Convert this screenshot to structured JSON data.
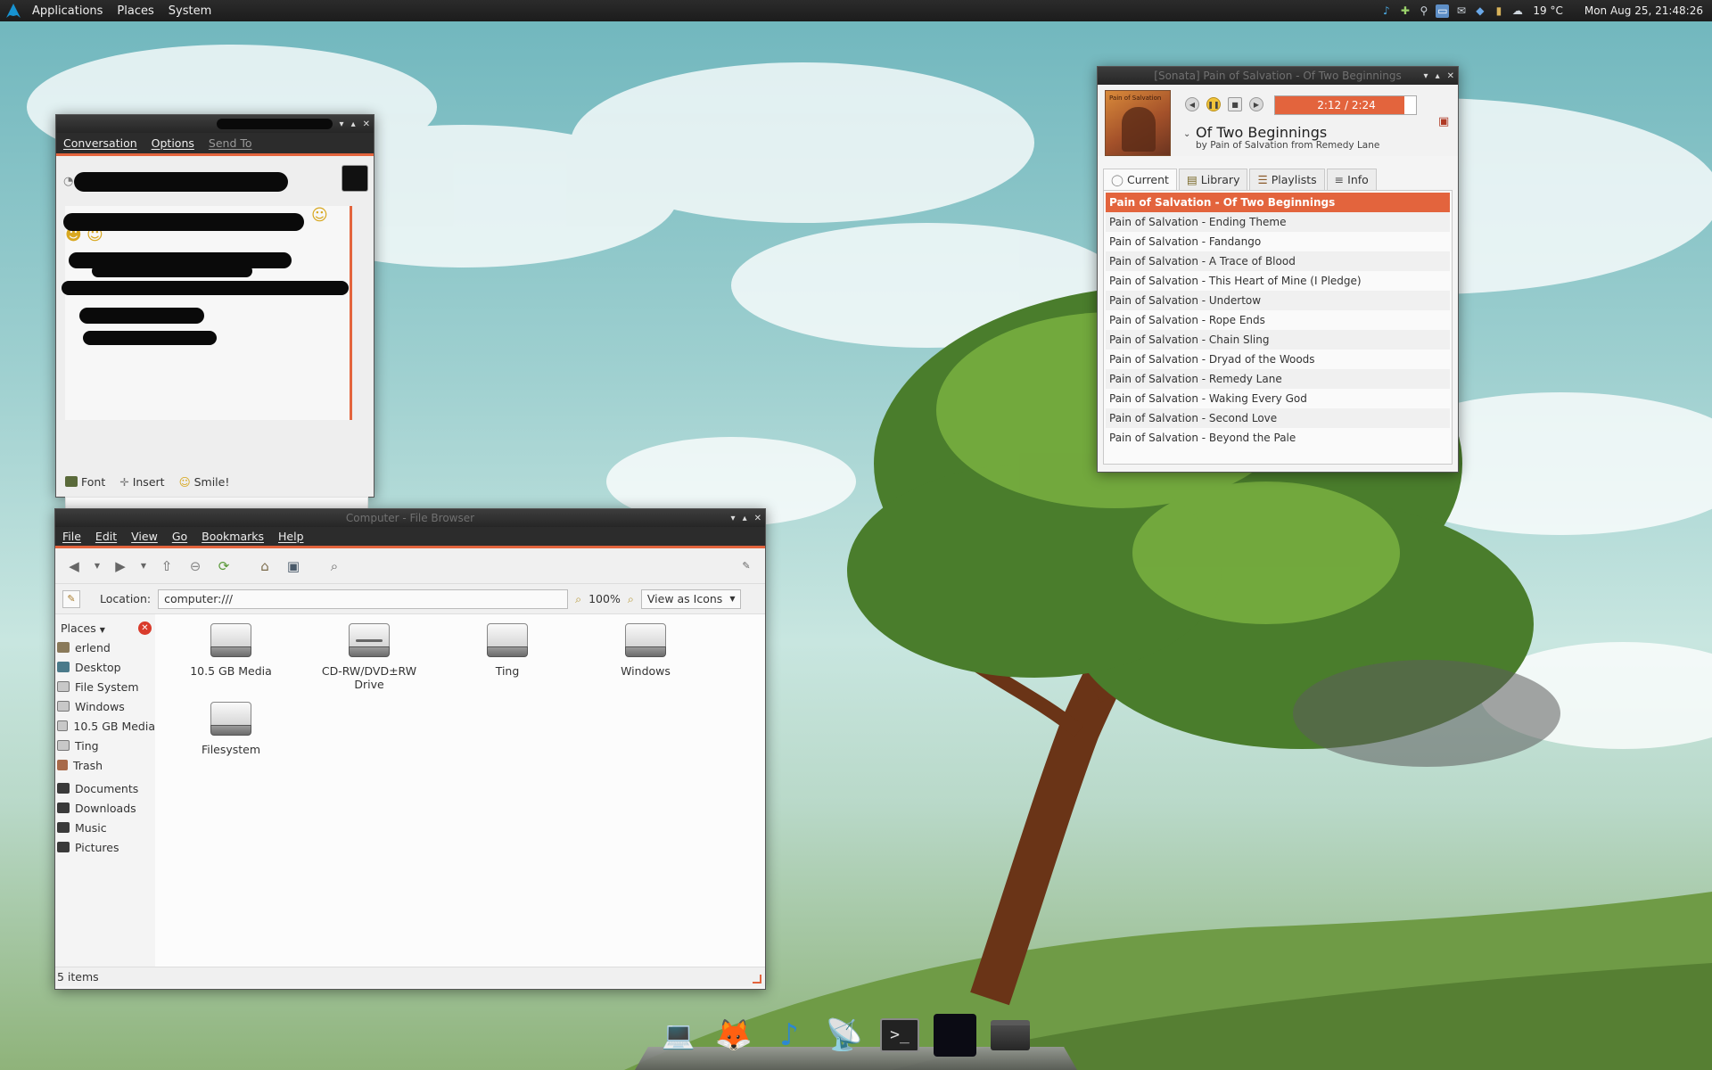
{
  "top_panel": {
    "menus": [
      "Applications",
      "Places",
      "System"
    ],
    "tray_icons": [
      "music-note-icon",
      "add-icon",
      "network-icon",
      "display-icon",
      "mail-icon",
      "shield-icon",
      "battery-icon",
      "weather-icon"
    ],
    "temperature": "19 °C",
    "clock": "Mon Aug 25, 21:48:26"
  },
  "chat_window": {
    "menus": [
      "Conversation",
      "Options",
      "Send To"
    ],
    "toolbar": {
      "font": "Font",
      "insert": "Insert",
      "smile": "Smile!"
    }
  },
  "player": {
    "window_title": "[Sonata] Pain of Salvation - Of Two Beginnings",
    "time": "2:12 / 2:24",
    "progress_fraction": 0.917,
    "track_title": "Of Two Beginnings",
    "track_subtitle": "by Pain of Salvation from Remedy Lane",
    "album_art_text": "Pain of Salvation",
    "tabs": [
      "Current",
      "Library",
      "Playlists",
      "Info"
    ],
    "playlist": [
      "Pain of Salvation - Of Two Beginnings",
      "Pain of Salvation - Ending Theme",
      "Pain of Salvation - Fandango",
      "Pain of Salvation - A Trace of Blood",
      "Pain of Salvation - This Heart of Mine (I Pledge)",
      "Pain of Salvation - Undertow",
      "Pain of Salvation - Rope Ends",
      "Pain of Salvation - Chain Sling",
      "Pain of Salvation - Dryad of the Woods",
      "Pain of Salvation - Remedy Lane",
      "Pain of Salvation - Waking Every God",
      "Pain of Salvation - Second Love",
      "Pain of Salvation - Beyond the Pale"
    ],
    "active_index": 0
  },
  "file_browser": {
    "window_title": "Computer - File Browser",
    "menus": [
      "File",
      "Edit",
      "View",
      "Go",
      "Bookmarks",
      "Help"
    ],
    "location_label": "Location:",
    "location_value": "computer:///",
    "zoom": "100%",
    "view_mode": "View as Icons",
    "sidebar_title": "Places",
    "places": [
      "erlend",
      "Desktop",
      "File System",
      "Windows",
      "10.5 GB Media",
      "Ting",
      "Trash"
    ],
    "bookmarks": [
      "Documents",
      "Downloads",
      "Music",
      "Pictures"
    ],
    "drives": [
      {
        "label": "10.5 GB Media",
        "label2": ""
      },
      {
        "label": "CD-RW/DVD±RW",
        "label2": "Drive"
      },
      {
        "label": "Ting",
        "label2": ""
      },
      {
        "label": "Windows",
        "label2": ""
      },
      {
        "label": "Filesystem",
        "label2": ""
      }
    ],
    "status": "5 items"
  },
  "dock": {
    "items": [
      "laptop-icon",
      "fox-browser-icon",
      "music-note-icon",
      "satellite-dish-icon",
      "terminal-icon",
      "chat-avatar-icon",
      "folder-icon"
    ]
  },
  "colors": {
    "accent": "#e3643d",
    "panel": "#1c1c1c",
    "window_bg": "#f4f4f4"
  }
}
